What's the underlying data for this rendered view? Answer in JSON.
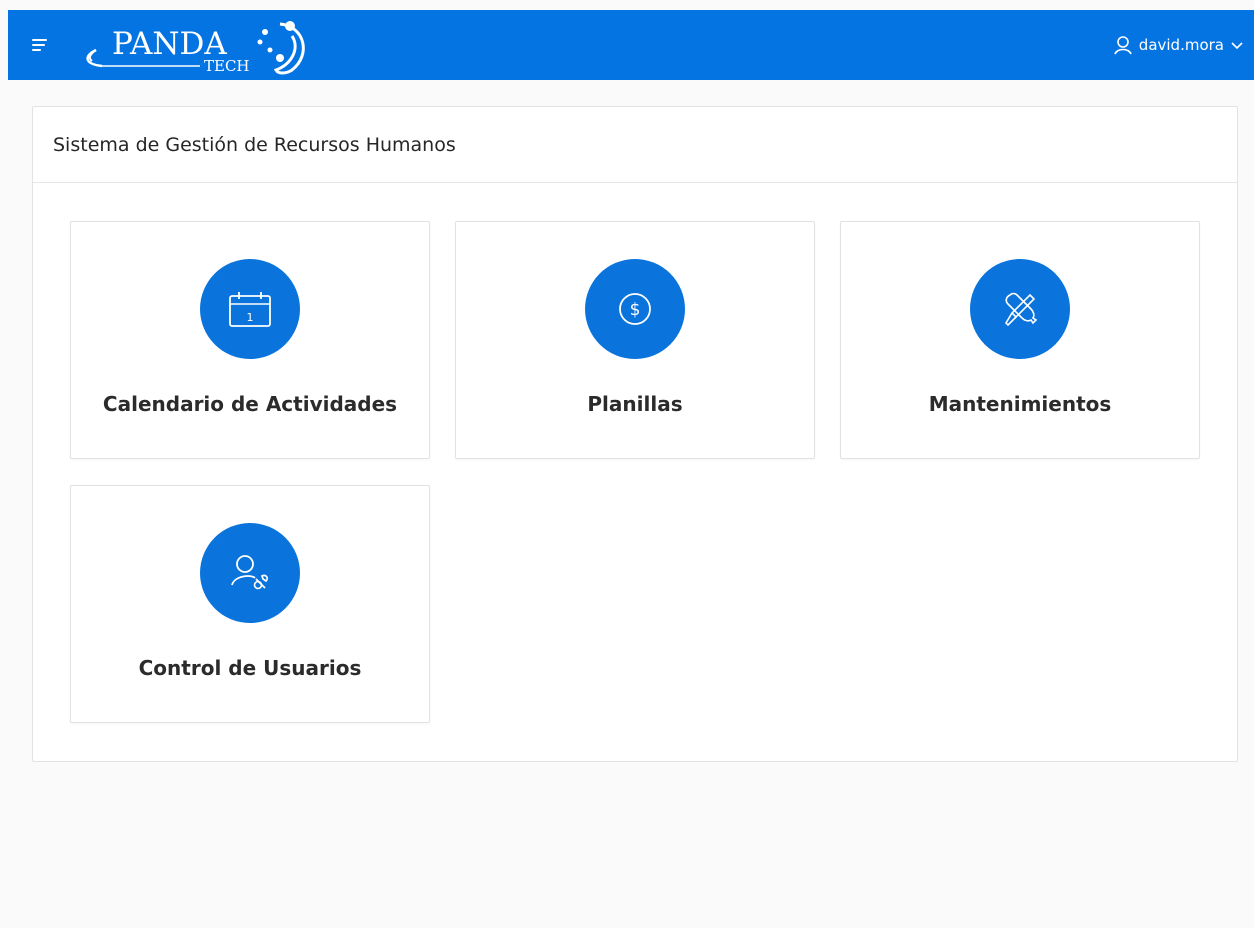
{
  "header": {
    "brand": "PANDA",
    "brand_sub": "TECH",
    "username": "david.mora"
  },
  "region": {
    "title": "Sistema de Gestión de Recursos Humanos"
  },
  "cards": [
    {
      "label": "Calendario de Actividades",
      "icon": "calendar-icon"
    },
    {
      "label": "Planillas",
      "icon": "dollar-icon"
    },
    {
      "label": "Mantenimientos",
      "icon": "tools-icon"
    },
    {
      "label": "Control de Usuarios",
      "icon": "user-wrench-icon"
    }
  ],
  "calendar_icon_text": "1",
  "colors": {
    "header_bg": "#0574e3",
    "icon_circle": "#0a74dc",
    "page_bg": "#fafafa"
  }
}
